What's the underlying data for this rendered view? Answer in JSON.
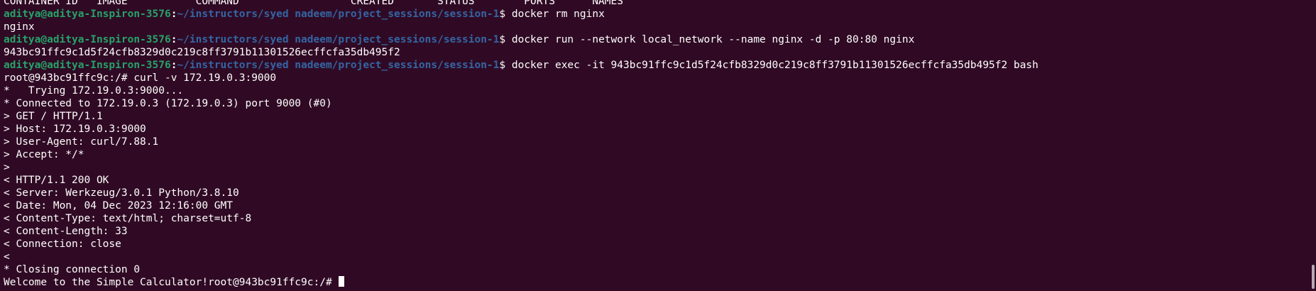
{
  "terminal": {
    "partial_top_line": "CONTAINER ID   IMAGE           COMMAND                  CREATED       STATUS        PORTS      NAMES",
    "lines": [
      {
        "type": "prompt",
        "user": "aditya@aditya-Inspiron-3576",
        "colon": ":",
        "path": "~/instructors/syed nadeem/project_sessions/session-1",
        "dollar": "$ ",
        "cmd": "docker rm nginx"
      },
      {
        "type": "output",
        "text": "nginx"
      },
      {
        "type": "prompt",
        "user": "aditya@aditya-Inspiron-3576",
        "colon": ":",
        "path": "~/instructors/syed nadeem/project_sessions/session-1",
        "dollar": "$ ",
        "cmd": "docker run --network local_network --name nginx -d -p 80:80 nginx"
      },
      {
        "type": "output",
        "text": "943bc91ffc9c1d5f24cfb8329d0c219c8ff3791b11301526ecffcfa35db495f2"
      },
      {
        "type": "prompt",
        "user": "aditya@aditya-Inspiron-3576",
        "colon": ":",
        "path": "~/instructors/syed nadeem/project_sessions/session-1",
        "dollar": "$ ",
        "cmd": "docker exec -it 943bc91ffc9c1d5f24cfb8329d0c219c8ff3791b11301526ecffcfa35db495f2 bash"
      },
      {
        "type": "output",
        "text": "root@943bc91ffc9c:/# curl -v 172.19.0.3:9000"
      },
      {
        "type": "output",
        "text": "*   Trying 172.19.0.3:9000..."
      },
      {
        "type": "output",
        "text": "* Connected to 172.19.0.3 (172.19.0.3) port 9000 (#0)"
      },
      {
        "type": "output",
        "text": "> GET / HTTP/1.1"
      },
      {
        "type": "output",
        "text": "> Host: 172.19.0.3:9000"
      },
      {
        "type": "output",
        "text": "> User-Agent: curl/7.88.1"
      },
      {
        "type": "output",
        "text": "> Accept: */*"
      },
      {
        "type": "output",
        "text": ">"
      },
      {
        "type": "output",
        "text": "< HTTP/1.1 200 OK"
      },
      {
        "type": "output",
        "text": "< Server: Werkzeug/3.0.1 Python/3.8.10"
      },
      {
        "type": "output",
        "text": "< Date: Mon, 04 Dec 2023 12:16:00 GMT"
      },
      {
        "type": "output",
        "text": "< Content-Type: text/html; charset=utf-8"
      },
      {
        "type": "output",
        "text": "< Content-Length: 33"
      },
      {
        "type": "output",
        "text": "< Connection: close"
      },
      {
        "type": "output",
        "text": "<"
      },
      {
        "type": "output",
        "text": "* Closing connection 0"
      },
      {
        "type": "output",
        "text": "Welcome to the Simple Calculator!root@943bc91ffc9c:/# ",
        "cursor": true
      }
    ]
  },
  "colors": {
    "background": "#300a24",
    "user": "#26a269",
    "path": "#3465a4",
    "text": "#ffffff"
  }
}
